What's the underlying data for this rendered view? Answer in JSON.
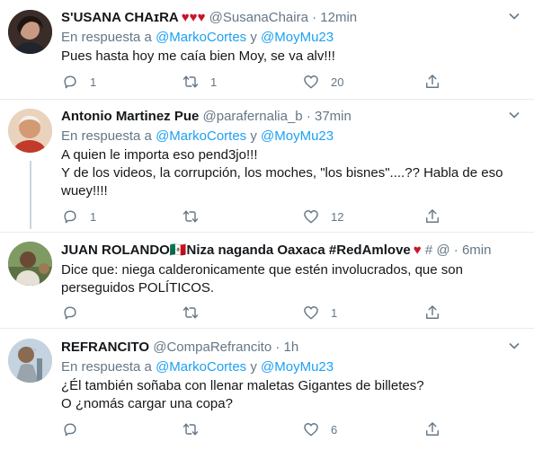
{
  "tweets": [
    {
      "name": "S'USANA CHAɪRA",
      "hearts": "♥♥♥",
      "handle": "@SusanaChaira",
      "dot": "·",
      "time": "12min",
      "reply_prefix": "En respuesta a",
      "reply_user1": "@MarkoCortes",
      "reply_and": "y",
      "reply_user2": "@MoyMu23",
      "text_lines": [
        "Pues hasta hoy me caía bien Moy, se va alv!!!"
      ],
      "replies": "1",
      "retweets": "1",
      "likes": "20"
    },
    {
      "name": "Antonio Martinez Pue",
      "hearts": "",
      "handle": "@parafernalia_b",
      "dot": "·",
      "time": "37min",
      "reply_prefix": "En respuesta a",
      "reply_user1": "@MarkoCortes",
      "reply_and": "y",
      "reply_user2": "@MoyMu23",
      "text_lines": [
        "A quien le importa eso pend3jo!!!",
        "Y de los videos, la corrupción, los moches, \"los bisnes\"....?? Habla de eso",
        "wuey!!!!"
      ],
      "replies": "1",
      "retweets": "",
      "likes": "12"
    },
    {
      "name": "JUAN ROLANDO🇲🇽Niza naganda Oaxaca #RedAmlove",
      "hearts": "♥",
      "handle": "# @",
      "dot": "·",
      "time": "6min",
      "text_lines": [
        "Dice que: niega calderonicamente que estén involucrados, que son",
        "perseguidos POLÍTICOS."
      ],
      "replies": "",
      "retweets": "",
      "likes": "1"
    },
    {
      "name": "REFRANCITO",
      "hearts": "",
      "handle": "@CompaRefrancito",
      "dot": "·",
      "time": "1h",
      "reply_prefix": "En respuesta a",
      "reply_user1": "@MarkoCortes",
      "reply_and": "y",
      "reply_user2": "@MoyMu23",
      "text_lines": [
        "¿Él también soñaba con llenar maletas Gigantes de billetes?",
        "O ¿nomás cargar una copa?"
      ],
      "replies": "",
      "retweets": "",
      "likes": "6"
    }
  ],
  "icons": {
    "reply": "reply-icon",
    "retweet": "retweet-icon",
    "like": "heart-icon",
    "share": "share-icon",
    "caret": "chevron-down-icon"
  },
  "colors": {
    "link": "#1da1f2",
    "secondary_text": "#657786",
    "heart_red": "#c7162b",
    "divider": "#e6ecf0"
  }
}
